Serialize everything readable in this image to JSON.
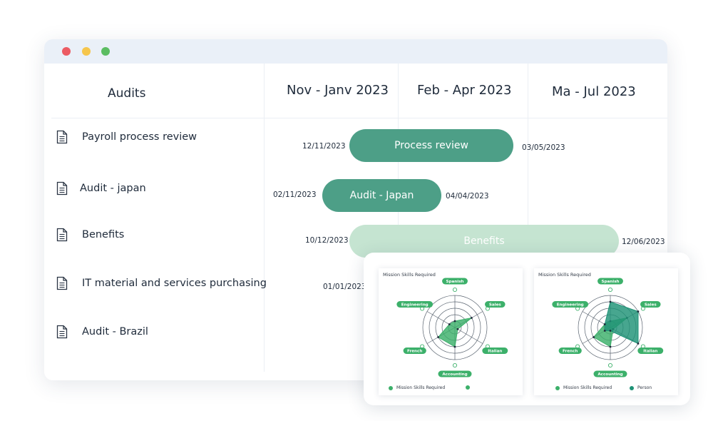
{
  "gantt": {
    "headers": {
      "audits": "Audits",
      "period1": "Nov - Janv 2023",
      "period2": "Feb - Apr 2023",
      "period3": "Ma - Jul 2023"
    },
    "rows": [
      {
        "label": "Payroll process review"
      },
      {
        "label": "Audit - japan"
      },
      {
        "label": "Benefits"
      },
      {
        "label": "IT material and services purchasing"
      },
      {
        "label": "Audit - Brazil"
      }
    ],
    "bars": [
      {
        "label": "Process review",
        "start": "12/11/2023",
        "end": "03/05/2023"
      },
      {
        "label": "Audit - Japan",
        "start": "02/11/2023",
        "end": "04/04/2023"
      },
      {
        "label": "Benefits",
        "start": "10/12/2023",
        "end": "12/06/2023"
      },
      {
        "start": "01/01/2023"
      }
    ]
  },
  "colors": {
    "accent": "#4d9f87",
    "accent_light": "#c5e4d1",
    "radar_green": "#3cb06a",
    "radar_dark": "#1e9276"
  },
  "chart_data": [
    {
      "type": "radar",
      "title": "Mission Skills Required",
      "axes": [
        "Spanish",
        "Sales",
        "Italian",
        "Accounting",
        "French",
        "Engineering"
      ],
      "rings": 5,
      "range": [
        0,
        5
      ],
      "series": [
        {
          "name": "Mission Skills Required",
          "values": [
            1,
            3,
            0.5,
            3,
            3,
            1
          ]
        },
        {
          "name": "",
          "values": []
        }
      ],
      "legend_position": "bottom"
    },
    {
      "type": "radar",
      "title": "Mission Skills Required",
      "axes": [
        "Spanish",
        "Sales",
        "Italian",
        "Accounting",
        "French",
        "Engineering"
      ],
      "rings": 5,
      "range": [
        0,
        5
      ],
      "series": [
        {
          "name": "Mission Skills Required",
          "values": [
            1,
            3,
            0.5,
            3,
            3,
            1
          ]
        },
        {
          "name": "Person",
          "values": [
            4,
            5,
            5,
            0.5,
            1,
            1
          ]
        }
      ],
      "legend_position": "bottom"
    }
  ]
}
